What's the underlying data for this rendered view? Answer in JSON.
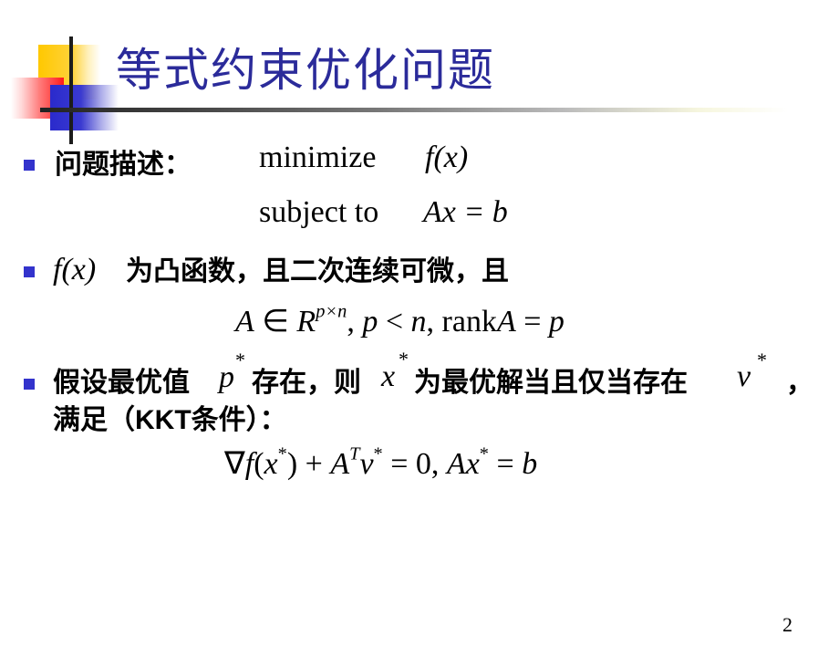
{
  "slide": {
    "title": "等式约束优化问题",
    "page_number": "2",
    "colors": {
      "title": "#2b2b9a",
      "bullet": "#3333cc"
    }
  },
  "bullets": [
    {
      "label": "问题描述：",
      "objective_keyword": "minimize",
      "objective_expr": "f(x)",
      "constraint_keyword": "subject to",
      "constraint_expr": "Ax = b"
    },
    {
      "func": "f(x)",
      "text": "为凸函数，且二次连续可微，且",
      "condition": "A ∈ R^{p×n}, p < n, rankA = p"
    },
    {
      "text_a": "假设最优值",
      "sym_p": "p",
      "star": "*",
      "text_b": "存在，则",
      "sym_x": "x",
      "text_c": "为最优解当且仅当存在",
      "sym_v": "ν",
      "text_d": "，",
      "line2_a": "满足（",
      "kkt": "KKT",
      "line2_b": "条件）：",
      "equation": "∇f(x*) + Aᵀν* = 0, Ax* = b"
    }
  ]
}
